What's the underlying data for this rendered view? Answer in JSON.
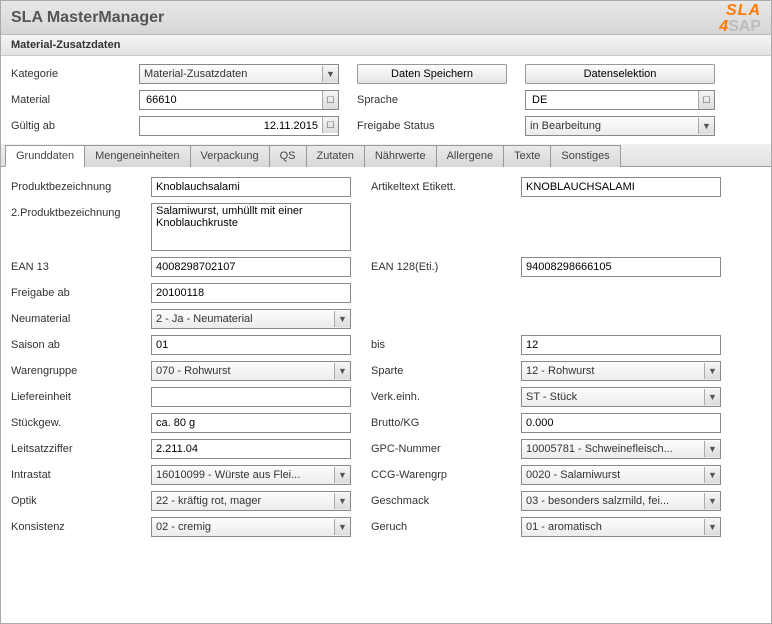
{
  "window": {
    "title": "SLA MasterManager",
    "subtitle": "Material-Zusatzdaten"
  },
  "logo": {
    "line1": "SLA",
    "line2_prefix": "4",
    "line2_suffix": "SAP"
  },
  "header": {
    "kategorie_label": "Kategorie",
    "kategorie_value": "Material-Zusatzdaten",
    "btn_save": "Daten Speichern",
    "btn_select": "Datenselektion",
    "material_label": "Material",
    "material_value": "66610",
    "sprache_label": "Sprache",
    "sprache_value": "DE",
    "gueltig_label": "Gültig ab",
    "gueltig_value": "12.11.2015",
    "freigabe_label": "Freigabe Status",
    "freigabe_value": "in Bearbeitung"
  },
  "tabs": {
    "t0": "Grunddaten",
    "t1": "Mengeneinheiten",
    "t2": "Verpackung",
    "t3": "QS",
    "t4": "Zutaten",
    "t5": "Nährwerte",
    "t6": "Allergene",
    "t7": "Texte",
    "t8": "Sonstiges"
  },
  "form": {
    "produktbez_label": "Produktbezeichnung",
    "produktbez_value": "Knoblauchsalami",
    "artikeltext_label": "Artikeltext Etikett.",
    "artikeltext_value": "KNOBLAUCHSALAMI",
    "produktbez2_label": "2.Produktbezeichnung",
    "produktbez2_value": "Salamiwurst, umhüllt mit einer Knoblauchkruste",
    "ean13_label": "EAN 13",
    "ean13_value": "4008298702107",
    "ean128_label": "EAN 128(Eti.)",
    "ean128_value": "94008298666105",
    "freigabeab_label": "Freigabe ab",
    "freigabeab_value": "20100118",
    "neumaterial_label": "Neumaterial",
    "neumaterial_value": "2 - Ja - Neumaterial",
    "saison_label": "Saison ab",
    "saison_value": "01",
    "saison_bis_label": "bis",
    "saison_bis_value": "12",
    "warengruppe_label": "Warengruppe",
    "warengruppe_value": "070 - Rohwurst",
    "sparte_label": "Sparte",
    "sparte_value": "12 - Rohwurst",
    "liefereinheit_label": "Liefereinheit",
    "liefereinheit_value": "",
    "verkeinh_label": "Verk.einh.",
    "verkeinh_value": "ST - Stück",
    "stueckgew_label": "Stückgew.",
    "stueckgew_value": "ca. 80 g",
    "bruttokg_label": "Brutto/KG",
    "bruttokg_value": "0.000",
    "leitsatz_label": "Leitsatzziffer",
    "leitsatz_value": "2.211.04",
    "gpc_label": "GPC-Nummer",
    "gpc_value": "10005781 - Schweinefleisch...",
    "intrastat_label": "Intrastat",
    "intrastat_value": "16010099 - Würste aus Flei...",
    "ccg_label": "CCG-Warengrp",
    "ccg_value": "0020 - Salamiwurst",
    "optik_label": "Optik",
    "optik_value": "22 - kräftig rot, mager",
    "geschmack_label": "Geschmack",
    "geschmack_value": "03 - besonders salzmild, fei...",
    "konsistenz_label": "Konsistenz",
    "konsistenz_value": "02 - cremig",
    "geruch_label": "Geruch",
    "geruch_value": "01 - aromatisch"
  }
}
